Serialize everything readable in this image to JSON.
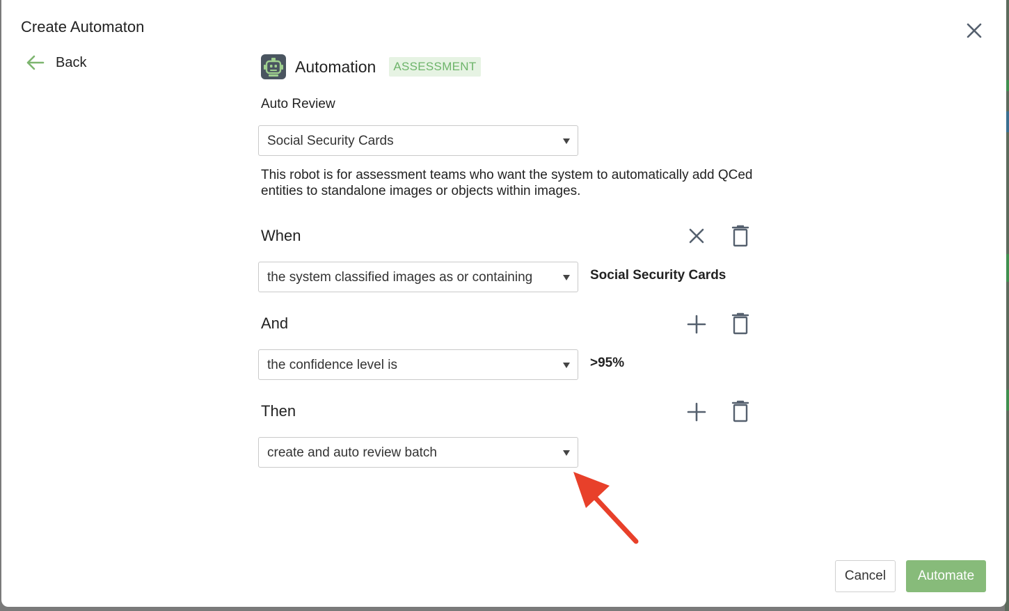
{
  "dialog": {
    "title": "Create Automaton",
    "back_label": "Back"
  },
  "header": {
    "name": "Automation",
    "badge": "ASSESSMENT"
  },
  "auto_review": {
    "label": "Auto Review",
    "selected": "Social Security Cards"
  },
  "description": "This robot is for assessment teams who want the system to automatically add QCed entities to standalone images or objects within images.",
  "rules": [
    {
      "label": "When",
      "condition": "the system classified images as or containing",
      "value": "Social Security Cards"
    },
    {
      "label": "And",
      "condition": "the confidence level is",
      "value": ">95%"
    },
    {
      "label": "Then",
      "condition": "create and auto review batch",
      "value": ""
    }
  ],
  "footer": {
    "cancel_label": "Cancel",
    "automate_label": "Automate"
  },
  "colors": {
    "accent_green": "#87bb7a",
    "badge_bg": "#e6f3e3",
    "badge_text": "#6db46a",
    "icon_gray": "#55606e",
    "annotation_red": "#e8402a"
  },
  "icons": {
    "close": "close-icon",
    "back": "arrow-left-icon",
    "robot": "robot-icon",
    "remove": "x-icon",
    "add": "plus-icon",
    "delete": "trash-icon",
    "annotation": "red-arrow-icon"
  }
}
